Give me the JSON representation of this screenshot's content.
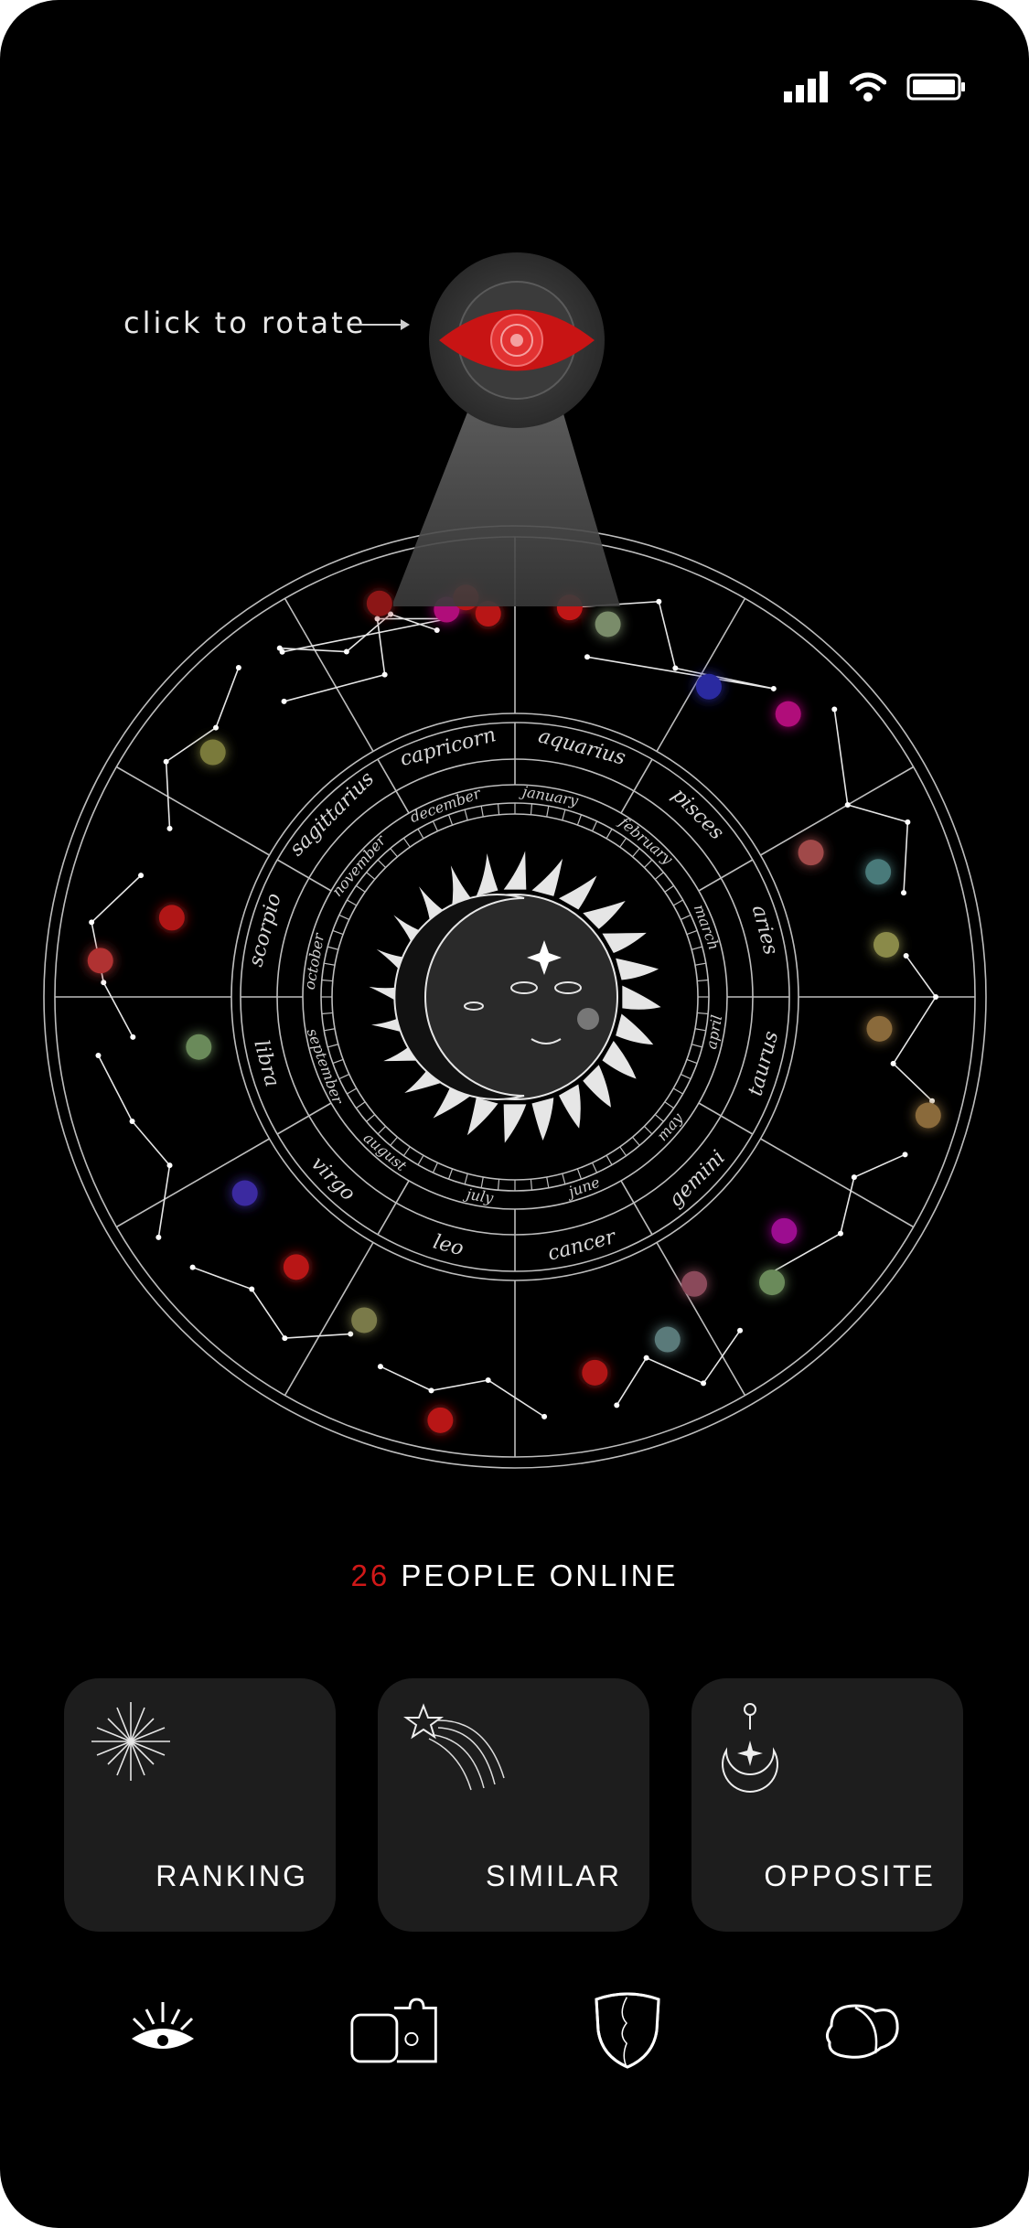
{
  "status_bar": {
    "icons": [
      "signal-icon",
      "wifi-icon",
      "battery-icon"
    ]
  },
  "rotate_hint": {
    "text": "click to rotate"
  },
  "zodiac_wheel": {
    "signs": [
      "capricorn",
      "aquarius",
      "pisces",
      "aries",
      "taurus",
      "gemini",
      "cancer",
      "leo",
      "virgo",
      "libra",
      "scorpio",
      "sagittarius"
    ],
    "months": [
      "january",
      "february",
      "march",
      "april",
      "may",
      "june",
      "july",
      "august",
      "september",
      "october",
      "november",
      "december"
    ]
  },
  "online": {
    "count": "26",
    "label": "PEOPLE ONLINE"
  },
  "cards": [
    {
      "label": "RANKING",
      "icon": "sparkle-star-icon"
    },
    {
      "label": "SIMILAR",
      "icon": "shooting-star-icon"
    },
    {
      "label": "OPPOSITE",
      "icon": "crescent-moon-icon"
    }
  ],
  "bottom_nav": [
    {
      "icon": "eye-icon"
    },
    {
      "icon": "cards-icon"
    },
    {
      "icon": "mask-icon"
    },
    {
      "icon": "chat-icon"
    }
  ],
  "colors": {
    "accent": "#d01818",
    "background": "#000000",
    "card": "#1d1d1d"
  }
}
